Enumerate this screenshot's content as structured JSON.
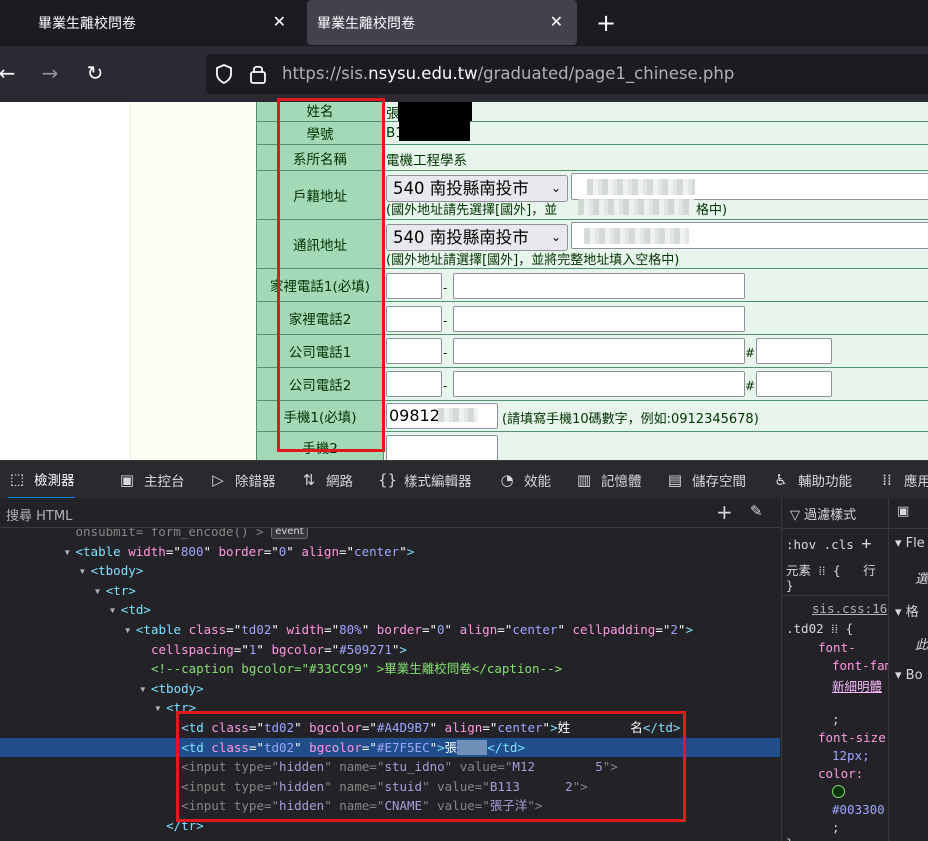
{
  "browser": {
    "tabs": [
      {
        "title": "畢業生離校問卷"
      },
      {
        "title": "畢業生離校問卷"
      }
    ],
    "new_tab_symbol": "+",
    "close_symbol": "✕",
    "url_prefix": "https://sis.",
    "url_domain": "nsysu.edu.tw",
    "url_path": "/graduated/page1_chinese.php"
  },
  "form": {
    "rows": [
      {
        "label": "姓名",
        "value": "張"
      },
      {
        "label": "學號",
        "value": "B1"
      },
      {
        "label": "系所名稱",
        "value": "電機工程學系"
      },
      {
        "label": "戶籍地址",
        "select": "540 南投縣南投市",
        "hint": "(國外地址請先選擇[國外]，並",
        "hint_tail": "格中)"
      },
      {
        "label": "通訊地址",
        "select": "540 南投縣南投市",
        "hint": "(國外地址請選擇[國外]，並將完整地址填入空格中)"
      },
      {
        "label": "家裡電話1(必填)"
      },
      {
        "label": "家裡電話2"
      },
      {
        "label": "公司電話1",
        "ext": "#"
      },
      {
        "label": "公司電話2",
        "ext": "#"
      },
      {
        "label": "手機1(必填)",
        "mobile_value": "09812",
        "hint": "(請填寫手機10碼數字，例如:0912345678)"
      },
      {
        "label": "手機2"
      }
    ],
    "dash": "-"
  },
  "devtools": {
    "tabs": [
      {
        "label": "檢測器",
        "icon": "inspector-icon"
      },
      {
        "label": "主控台",
        "icon": "console-icon"
      },
      {
        "label": "除錯器",
        "icon": "debugger-icon"
      },
      {
        "label": "網路",
        "icon": "network-icon"
      },
      {
        "label": "樣式編輯器",
        "icon": "style-editor-icon"
      },
      {
        "label": "效能",
        "icon": "performance-icon"
      },
      {
        "label": "記憶體",
        "icon": "memory-icon"
      },
      {
        "label": "儲存空間",
        "icon": "storage-icon"
      },
      {
        "label": "輔助功能",
        "icon": "accessibility-icon"
      },
      {
        "label": "應用",
        "icon": "application-icon"
      }
    ],
    "search_placeholder": "搜尋 HTML",
    "event_badge": "event",
    "filter_styles": "過濾樣式",
    "hov": ":hov",
    "cls": ".cls",
    "element_label": "元素",
    "rule_source": "sis.css:16",
    "selector": ".td02",
    "prop_font_family": "font-family:",
    "font_family_value": "新細明體",
    "prop_font_size": "font-size:",
    "font_size_value": "12px;",
    "prop_color": "color:",
    "color_value": "#003300",
    "layout_labels": [
      "Fle",
      "選",
      "格",
      "此",
      "Bo"
    ],
    "html_lines": [
      {
        "indent": 10,
        "text": "onsubmit= form_encode() >"
      },
      {
        "indent": 10,
        "tag": "table",
        "attrs": [
          [
            "width",
            "800"
          ],
          [
            "border",
            "0"
          ],
          [
            "align",
            "center"
          ]
        ]
      },
      {
        "indent": 12,
        "tag": "tbody"
      },
      {
        "indent": 14,
        "tag": "tr"
      },
      {
        "indent": 16,
        "tag": "td"
      },
      {
        "indent": 18,
        "tag": "table",
        "attrs": [
          [
            "class",
            "td02"
          ],
          [
            "width",
            "80%"
          ],
          [
            "border",
            "0"
          ],
          [
            "align",
            "center"
          ],
          [
            "cellpadding",
            "2"
          ]
        ]
      },
      {
        "indent": 20,
        "cont": [
          [
            "cellspacing",
            "1"
          ],
          [
            "bgcolor",
            "#509271"
          ]
        ]
      },
      {
        "indent": 20,
        "comment": "<!--caption bgcolor=\"#33CC99\" >畢業生離校問卷</caption-->"
      },
      {
        "indent": 20,
        "tag": "tbody"
      },
      {
        "indent": 22,
        "tag": "tr"
      },
      {
        "indent": 24,
        "tag": "td",
        "attrs": [
          [
            "class",
            "td02"
          ],
          [
            "bgcolor",
            "#A4D9B7"
          ],
          [
            "align",
            "center"
          ]
        ],
        "content": "姓        名"
      },
      {
        "indent": 24,
        "tag": "td",
        "attrs": [
          [
            "class",
            "td02"
          ],
          [
            "bgcolor",
            "#E7F5EC"
          ]
        ],
        "content": "張"
      },
      {
        "indent": 24,
        "tag": "input",
        "dim": true,
        "attrs": [
          [
            "type",
            "hidden"
          ],
          [
            "name",
            "stu_idno"
          ],
          [
            "value",
            "M12        5"
          ]
        ]
      },
      {
        "indent": 24,
        "tag": "input",
        "dim": true,
        "attrs": [
          [
            "type",
            "hidden"
          ],
          [
            "name",
            "stuid"
          ],
          [
            "value",
            "B113      2"
          ]
        ]
      },
      {
        "indent": 24,
        "tag": "input",
        "dim": true,
        "attrs": [
          [
            "type",
            "hidden"
          ],
          [
            "name",
            "CNAME"
          ],
          [
            "value",
            "張子洋"
          ]
        ]
      },
      {
        "indent": 22,
        "close": "tr"
      }
    ]
  }
}
